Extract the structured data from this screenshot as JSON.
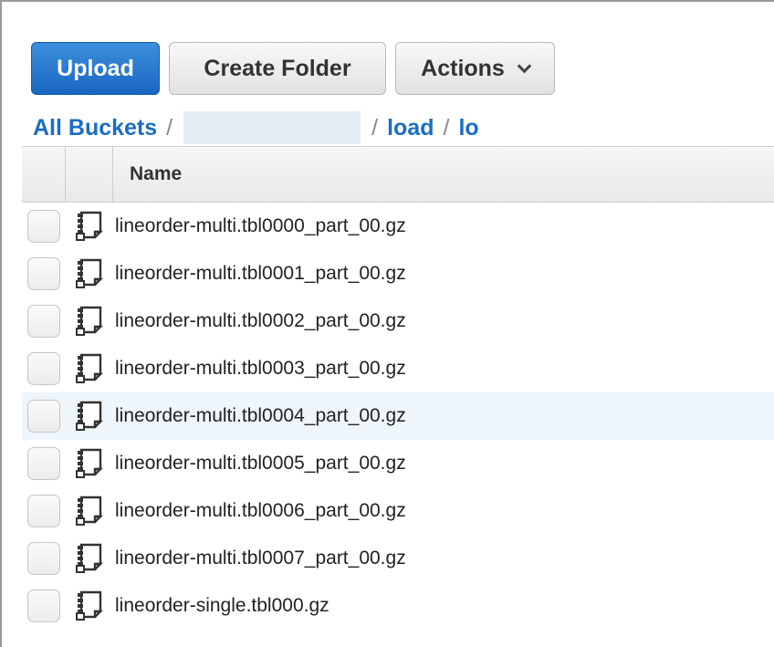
{
  "toolbar": {
    "upload_label": "Upload",
    "create_folder_label": "Create Folder",
    "actions_label": "Actions"
  },
  "breadcrumb": {
    "root": "All Buckets",
    "sep": "/",
    "segments": [
      "load",
      "lo"
    ]
  },
  "table": {
    "columns": [
      "Name"
    ],
    "rows": [
      {
        "name": "lineorder-multi.tbl0000_part_00.gz"
      },
      {
        "name": "lineorder-multi.tbl0001_part_00.gz"
      },
      {
        "name": "lineorder-multi.tbl0002_part_00.gz"
      },
      {
        "name": "lineorder-multi.tbl0003_part_00.gz"
      },
      {
        "name": "lineorder-multi.tbl0004_part_00.gz"
      },
      {
        "name": "lineorder-multi.tbl0005_part_00.gz"
      },
      {
        "name": "lineorder-multi.tbl0006_part_00.gz"
      },
      {
        "name": "lineorder-multi.tbl0007_part_00.gz"
      },
      {
        "name": "lineorder-single.tbl000.gz"
      }
    ]
  },
  "icons": {
    "file": "zip-file-icon",
    "dropdown": "chevron-down-icon"
  },
  "colors": {
    "primary": "#1a66c2",
    "link": "#1a6ec4",
    "row_hover": "#eef5fb"
  }
}
